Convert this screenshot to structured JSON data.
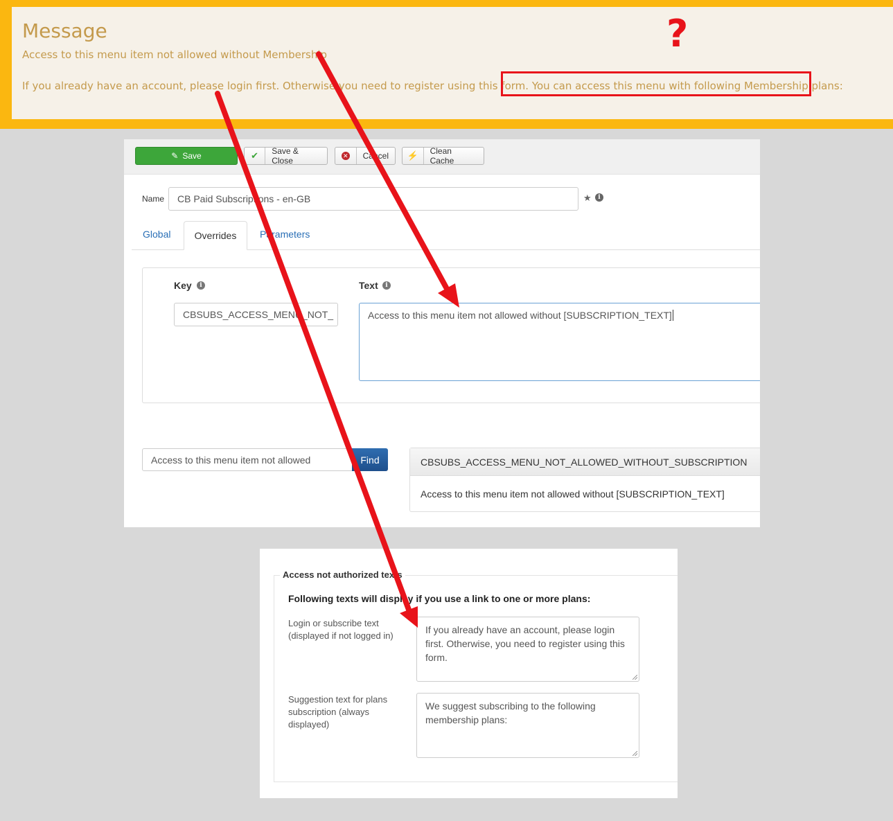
{
  "message": {
    "title": "Message",
    "line1": "Access to this menu item not allowed without Membership",
    "line2": "If you already have an account, please login first. Otherwise you need to register using this form.",
    "line2_highlight": "You can access this menu with following Membership plans:",
    "annotation": "?"
  },
  "toolbar": {
    "save": "Save",
    "save_close": "Save & Close",
    "cancel": "Cancel",
    "clean_cache": "Clean Cache"
  },
  "form": {
    "name_label": "Name",
    "name_value": "CB Paid Subscriptions - en-GB",
    "tabs": [
      "Global",
      "Overrides",
      "Parameters"
    ],
    "key_label": "Key",
    "text_label": "Text",
    "key_value": "CBSUBS_ACCESS_MENU_NOT_",
    "text_value": "Access to this menu item not allowed without [SUBSCRIPTION_TEXT]"
  },
  "search": {
    "value": "Access to this menu item not allowed",
    "find": "Find",
    "result_key": "CBSUBS_ACCESS_MENU_NOT_ALLOWED_WITHOUT_SUBSCRIPTION",
    "result_text": "Access to this menu item not allowed without [SUBSCRIPTION_TEXT]"
  },
  "access_texts": {
    "legend": "Access not authorized texts",
    "subhead": "Following texts will display if you use a link to one or more plans:",
    "login_label": "Login or subscribe text (displayed if not logged in)",
    "login_value": "If you already have an account, please login first. Otherwise, you need to register using this form.",
    "suggest_label": "Suggestion text for plans subscription (always displayed)",
    "suggest_value": "We suggest subscribing to the following membership plans:"
  },
  "colors": {
    "banner": "#fbb710",
    "annotation_red": "#e8131a",
    "save_green": "#3da63a",
    "find_blue": "#1e4f8c"
  }
}
